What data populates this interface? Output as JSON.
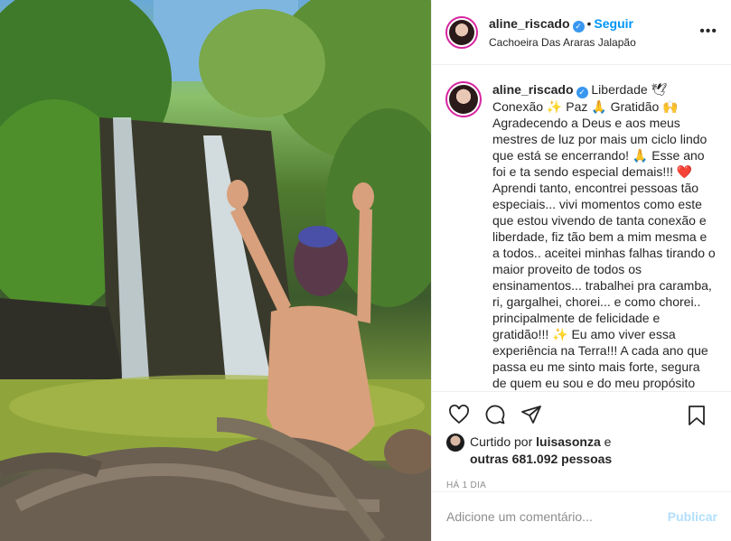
{
  "post": {
    "username": "aline_riscado",
    "follow_label": "Seguir",
    "dot": "•",
    "location": "Cachoeira Das Araras Jalapão",
    "more_label": "•••",
    "verified_mark": "✓"
  },
  "caption": {
    "username": "aline_riscado",
    "text": "Liberdade 🕊 Conexão ✨ Paz 🙏 Gratidão 🙌 Agradecendo a Deus e aos meus mestres de luz por mais um ciclo lindo que está se encerrando! 🙏 Esse ano foi e ta sendo especial demais!!! ❤️ Aprendi tanto, encontrei pessoas tão especiais... vivi momentos como este que estou vivendo de tanta conexão e liberdade, fiz tão bem a mim mesma e a todos.. aceitei minhas falhas tirando o maior proveito de todos os ensinamentos... trabalhei pra caramba, ri, gargalhei, chorei... e como chorei.. principalmente de felicidade e gratidão!!! ✨ Eu amo viver essa experiência na Terra!!! A cada ano que passa eu me sinto mais forte, segura de quem eu sou e do meu propósito"
  },
  "likes": {
    "prefix": "Curtido por",
    "user": "luisasonza",
    "conj": "e",
    "others": "outras 681.092 pessoas"
  },
  "time_ago": "HÁ 1 DIA",
  "comment_box": {
    "placeholder": "Adicione um comentário...",
    "publish_label": "Publicar"
  },
  "icons": {
    "like": "heart-icon",
    "comment": "comment-icon",
    "share": "share-icon",
    "save": "bookmark-icon"
  },
  "colors": {
    "follow": "#0095f6",
    "verified": "#3897f0",
    "publish_disabled": "#b2dffc",
    "muted": "#8e8e8e"
  }
}
